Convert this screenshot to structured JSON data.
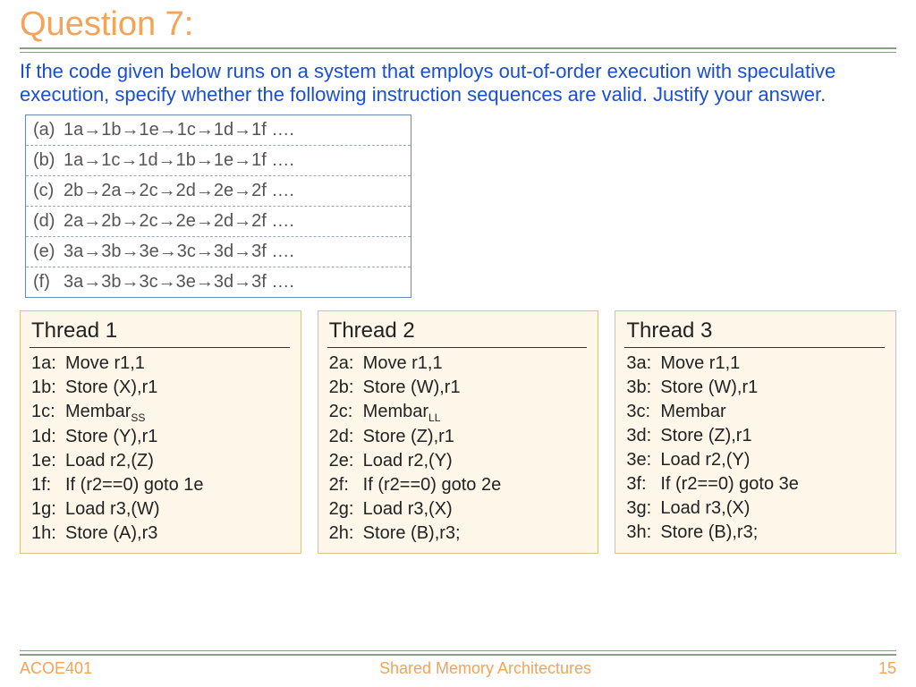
{
  "title": "Question 7:",
  "prompt": "If the code given below runs on a system that employs out-of-order execution with speculative execution, specify whether the following instruction sequences are valid. Justify your answer.",
  "sequences": [
    {
      "label": "(a)",
      "steps": [
        "1a",
        "1b",
        "1e",
        "1c",
        "1d",
        "1f"
      ],
      "tail": " …."
    },
    {
      "label": "(b)",
      "steps": [
        "1a",
        "1c",
        "1d",
        "1b",
        "1e",
        "1f"
      ],
      "tail": " …."
    },
    {
      "label": "(c)",
      "steps": [
        "2b",
        "2a",
        "2c",
        "2d",
        "2e",
        "2f"
      ],
      "tail": " …."
    },
    {
      "label": "(d)",
      "steps": [
        "2a",
        "2b",
        "2c",
        "2e",
        "2d",
        "2f"
      ],
      "tail": " …."
    },
    {
      "label": "(e)",
      "steps": [
        "3a",
        "3b",
        "3e",
        "3c",
        "3d",
        "3f"
      ],
      "tail": " …."
    },
    {
      "label": "(f)",
      "steps": [
        "3a",
        "3b",
        "3c",
        "3e",
        "3d",
        "3f"
      ],
      "tail": " …."
    }
  ],
  "threads": [
    {
      "title": "Thread 1",
      "lines": [
        {
          "n": "1a:",
          "t": "Move r1,1"
        },
        {
          "n": "1b:",
          "t": "Store (X),r1"
        },
        {
          "n": "1c:",
          "t": "Membar",
          "sub": "SS"
        },
        {
          "n": "1d:",
          "t": "Store (Y),r1"
        },
        {
          "n": "1e:",
          "t": "Load r2,(Z)"
        },
        {
          "n": "1f:",
          "t": "If (r2==0) goto 1e"
        },
        {
          "n": "1g:",
          "t": "Load r3,(W)"
        },
        {
          "n": "1h:",
          "t": "Store (A),r3"
        }
      ]
    },
    {
      "title": "Thread 2",
      "lines": [
        {
          "n": "2a:",
          "t": "Move r1,1"
        },
        {
          "n": "2b:",
          "t": "Store (W),r1"
        },
        {
          "n": "2c:",
          "t": "Membar",
          "sub": "LL"
        },
        {
          "n": "2d:",
          "t": "Store (Z),r1"
        },
        {
          "n": "2e:",
          "t": "Load r2,(Y)"
        },
        {
          "n": "2f:",
          "t": "If (r2==0) goto 2e"
        },
        {
          "n": "2g:",
          "t": "Load r3,(X)"
        },
        {
          "n": "2h:",
          "t": "Store (B),r3;"
        }
      ]
    },
    {
      "title": "Thread 3",
      "lines": [
        {
          "n": "3a:",
          "t": "Move r1,1"
        },
        {
          "n": "3b:",
          "t": "Store (W),r1"
        },
        {
          "n": "3c:",
          "t": "Membar"
        },
        {
          "n": "3d:",
          "t": "Store (Z),r1"
        },
        {
          "n": "3e:",
          "t": "Load r2,(Y)"
        },
        {
          "n": "3f:",
          "t": "If (r2==0) goto 3e"
        },
        {
          "n": "3g:",
          "t": "Load r3,(X)"
        },
        {
          "n": "3h:",
          "t": "Store (B),r3;"
        }
      ]
    }
  ],
  "footer": {
    "left": "ACOE401",
    "center": "Shared Memory Architectures",
    "right": "15"
  },
  "glyph": {
    "arrow": "→"
  }
}
